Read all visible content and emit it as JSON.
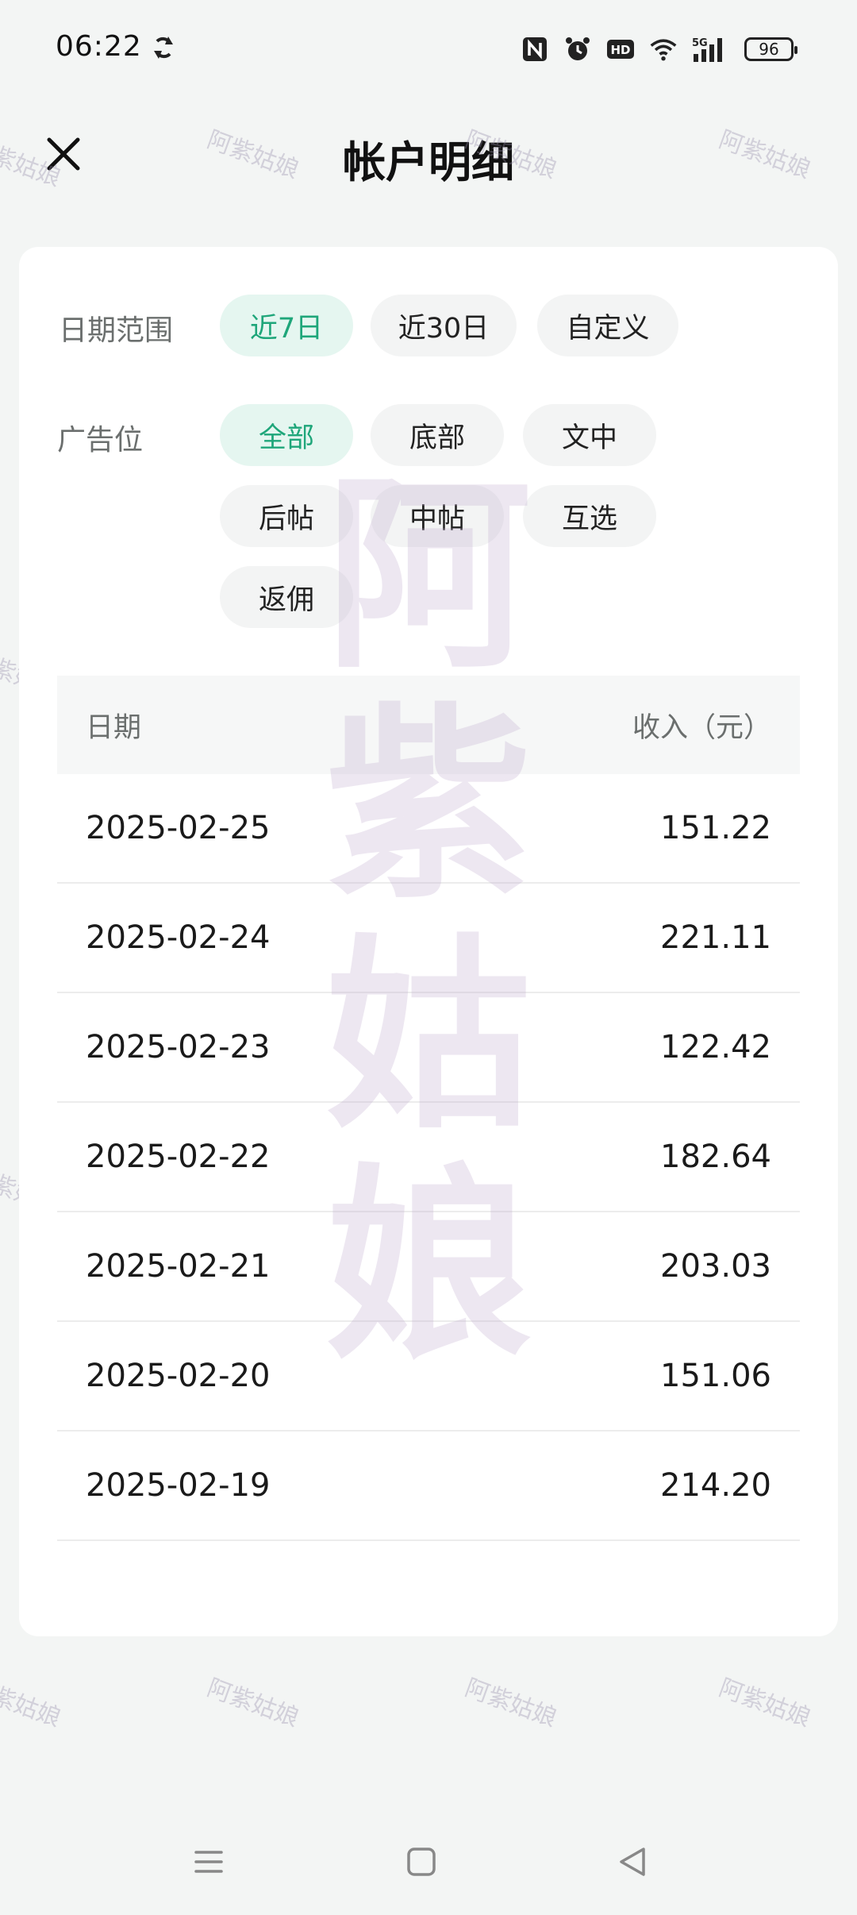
{
  "status_bar": {
    "time": "06:22",
    "battery": "96",
    "icons": [
      "sync-icon",
      "nfc-icon",
      "alarm-icon",
      "hd-icon",
      "wifi-icon",
      "5g-signal-icon",
      "battery-icon"
    ]
  },
  "header": {
    "title": "帐户明细"
  },
  "filters": {
    "date_range": {
      "label": "日期范围",
      "options": [
        "近7日",
        "近30日",
        "自定义"
      ],
      "selected": "近7日"
    },
    "ad_position": {
      "label": "广告位",
      "options": [
        "全部",
        "底部",
        "文中",
        "后帖",
        "中帖",
        "互选",
        "返佣"
      ],
      "selected": "全部"
    }
  },
  "table": {
    "columns": [
      "日期",
      "收入（元）"
    ],
    "rows": [
      {
        "date": "2025-02-25",
        "income": "151.22"
      },
      {
        "date": "2025-02-24",
        "income": "221.11"
      },
      {
        "date": "2025-02-23",
        "income": "122.42"
      },
      {
        "date": "2025-02-22",
        "income": "182.64"
      },
      {
        "date": "2025-02-21",
        "income": "203.03"
      },
      {
        "date": "2025-02-20",
        "income": "151.06"
      },
      {
        "date": "2025-02-19",
        "income": "214.20"
      }
    ]
  },
  "watermark": {
    "small": "阿紫姑娘",
    "large": [
      "阿",
      "紫",
      "姑",
      "娘"
    ]
  },
  "colors": {
    "accent": "#1fa67a",
    "chip_active_bg": "#e5f6f0",
    "chip_bg": "#f3f4f4",
    "page_bg": "#f3f5f4"
  }
}
